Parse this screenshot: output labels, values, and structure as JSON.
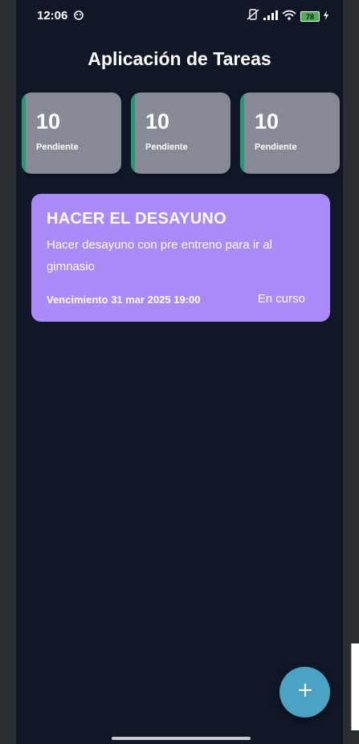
{
  "statusbar": {
    "time": "12:06",
    "battery": "78"
  },
  "app": {
    "title": "Aplicación de Tareas"
  },
  "stats": [
    {
      "count": "10",
      "label": "Pendiente"
    },
    {
      "count": "10",
      "label": "Pendiente"
    },
    {
      "count": "10",
      "label": "Pendiente"
    }
  ],
  "task": {
    "title": "HACER EL DESAYUNO",
    "description": "Hacer desayuno con pre entreno para ir al gimnasio",
    "due": "Vencimiento 31 mar 2025 19:00",
    "status": "En curso"
  },
  "colors": {
    "background": "#101726",
    "stat_card": "#858a95",
    "stat_accent": "#1e9e73",
    "task_card": "#a88bf9",
    "fab": "#4aa3c4"
  },
  "icons": {
    "fab": "plus-icon"
  }
}
